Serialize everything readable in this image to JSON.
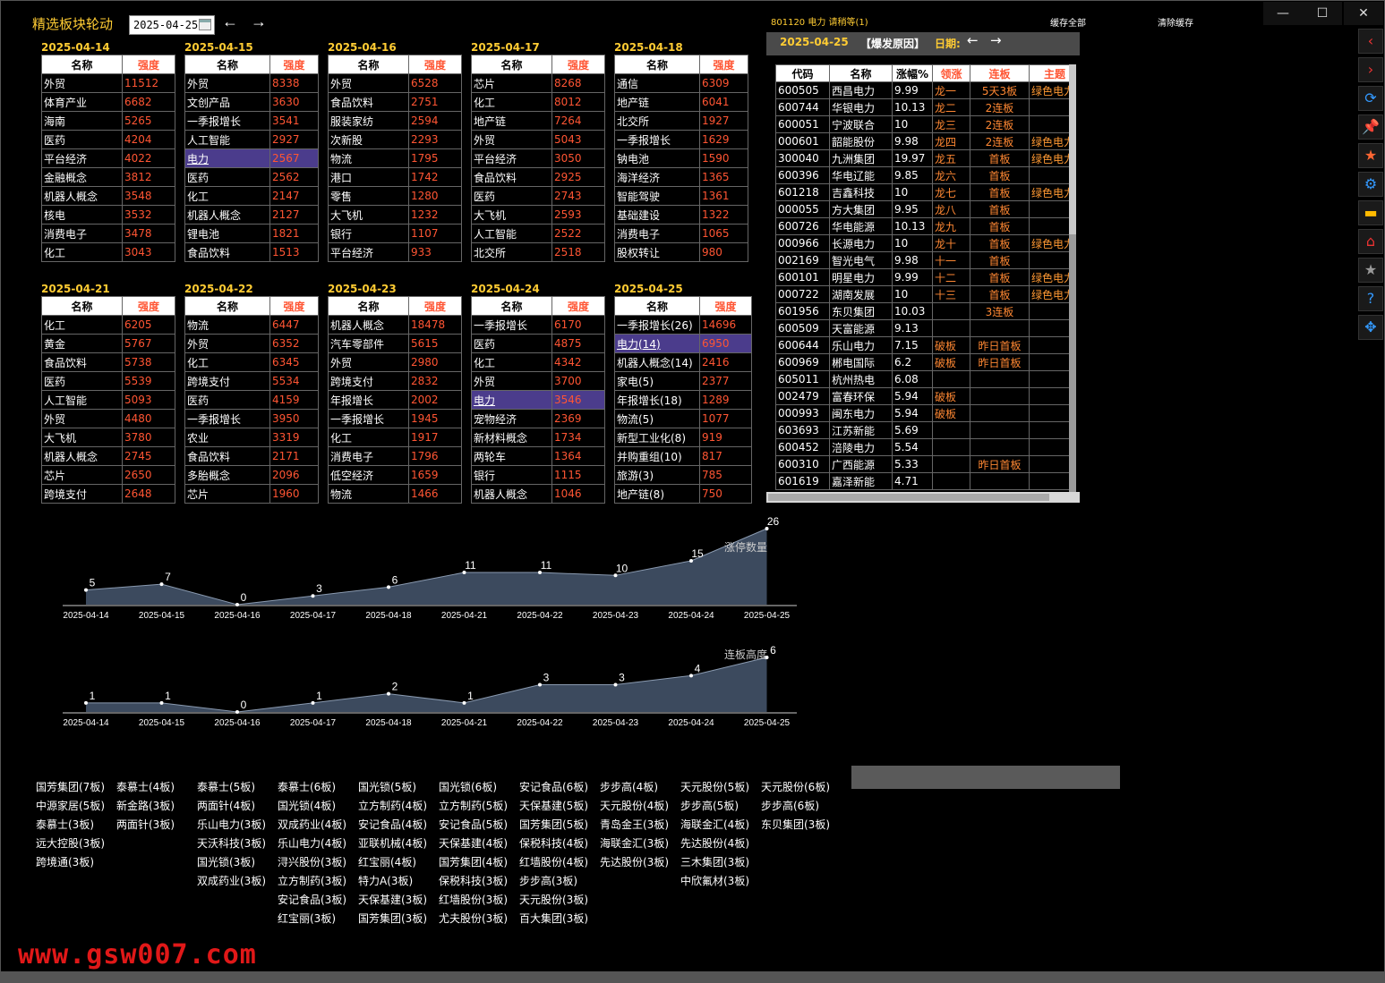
{
  "app_title": "精选板块轮动",
  "date_value": "2025-04-25",
  "nav": {
    "prev": "←",
    "next": "→"
  },
  "top_info": "801120 电力 请稍等(1)",
  "top_links": {
    "cache_all": "缓存全部",
    "clear_cache": "清除缓存"
  },
  "window_controls": {
    "minimize": "—",
    "maximize": "☐",
    "close": "✕"
  },
  "board_headers": {
    "name": "名称",
    "strength": "强度"
  },
  "boards": [
    {
      "date": "2025-04-14",
      "rows": [
        [
          "外贸",
          "11512"
        ],
        [
          "体育产业",
          "6682"
        ],
        [
          "海南",
          "5265"
        ],
        [
          "医药",
          "4204"
        ],
        [
          "平台经济",
          "4022"
        ],
        [
          "金融概念",
          "3812"
        ],
        [
          "机器人概念",
          "3548"
        ],
        [
          "核电",
          "3532"
        ],
        [
          "消费电子",
          "3478"
        ],
        [
          "化工",
          "3043"
        ]
      ],
      "highlight": -1
    },
    {
      "date": "2025-04-15",
      "rows": [
        [
          "外贸",
          "8338"
        ],
        [
          "文创产品",
          "3630"
        ],
        [
          "一季报增长",
          "3541"
        ],
        [
          "人工智能",
          "2927"
        ],
        [
          "电力",
          "2567"
        ],
        [
          "医药",
          "2562"
        ],
        [
          "化工",
          "2147"
        ],
        [
          "机器人概念",
          "2127"
        ],
        [
          "锂电池",
          "1821"
        ],
        [
          "食品饮料",
          "1513"
        ]
      ],
      "highlight": 4
    },
    {
      "date": "2025-04-16",
      "rows": [
        [
          "外贸",
          "6528"
        ],
        [
          "食品饮料",
          "2751"
        ],
        [
          "服装家纺",
          "2594"
        ],
        [
          "次新股",
          "2293"
        ],
        [
          "物流",
          "1795"
        ],
        [
          "港口",
          "1742"
        ],
        [
          "零售",
          "1280"
        ],
        [
          "大飞机",
          "1232"
        ],
        [
          "银行",
          "1107"
        ],
        [
          "平台经济",
          "933"
        ]
      ],
      "highlight": -1
    },
    {
      "date": "2025-04-17",
      "rows": [
        [
          "芯片",
          "8268"
        ],
        [
          "化工",
          "8012"
        ],
        [
          "地产链",
          "7264"
        ],
        [
          "外贸",
          "5043"
        ],
        [
          "平台经济",
          "3050"
        ],
        [
          "食品饮料",
          "2925"
        ],
        [
          "医药",
          "2743"
        ],
        [
          "大飞机",
          "2593"
        ],
        [
          "人工智能",
          "2522"
        ],
        [
          "北交所",
          "2518"
        ]
      ],
      "highlight": -1
    },
    {
      "date": "2025-04-18",
      "rows": [
        [
          "通信",
          "6309"
        ],
        [
          "地产链",
          "6041"
        ],
        [
          "北交所",
          "1927"
        ],
        [
          "一季报增长",
          "1629"
        ],
        [
          "钠电池",
          "1590"
        ],
        [
          "海洋经济",
          "1365"
        ],
        [
          "智能驾驶",
          "1361"
        ],
        [
          "基础建设",
          "1322"
        ],
        [
          "消费电子",
          "1065"
        ],
        [
          "股权转让",
          "980"
        ]
      ],
      "highlight": -1
    },
    {
      "date": "2025-04-21",
      "rows": [
        [
          "化工",
          "6205"
        ],
        [
          "黄金",
          "5767"
        ],
        [
          "食品饮料",
          "5738"
        ],
        [
          "医药",
          "5539"
        ],
        [
          "人工智能",
          "5093"
        ],
        [
          "外贸",
          "4480"
        ],
        [
          "大飞机",
          "3780"
        ],
        [
          "机器人概念",
          "2745"
        ],
        [
          "芯片",
          "2650"
        ],
        [
          "跨境支付",
          "2648"
        ]
      ],
      "highlight": -1
    },
    {
      "date": "2025-04-22",
      "rows": [
        [
          "物流",
          "6447"
        ],
        [
          "外贸",
          "6352"
        ],
        [
          "化工",
          "6345"
        ],
        [
          "跨境支付",
          "5534"
        ],
        [
          "医药",
          "4159"
        ],
        [
          "一季报增长",
          "3950"
        ],
        [
          "农业",
          "3319"
        ],
        [
          "食品饮料",
          "2171"
        ],
        [
          "多胎概念",
          "2096"
        ],
        [
          "芯片",
          "1960"
        ]
      ],
      "highlight": -1
    },
    {
      "date": "2025-04-23",
      "rows": [
        [
          "机器人概念",
          "18478"
        ],
        [
          "汽车零部件",
          "5615"
        ],
        [
          "外贸",
          "2980"
        ],
        [
          "跨境支付",
          "2832"
        ],
        [
          "年报增长",
          "2002"
        ],
        [
          "一季报增长",
          "1945"
        ],
        [
          "化工",
          "1917"
        ],
        [
          "消费电子",
          "1796"
        ],
        [
          "低空经济",
          "1659"
        ],
        [
          "物流",
          "1466"
        ]
      ],
      "highlight": -1
    },
    {
      "date": "2025-04-24",
      "rows": [
        [
          "一季报增长",
          "6170"
        ],
        [
          "医药",
          "4875"
        ],
        [
          "化工",
          "4342"
        ],
        [
          "外贸",
          "3700"
        ],
        [
          "电力",
          "3546"
        ],
        [
          "宠物经济",
          "2369"
        ],
        [
          "新材料概念",
          "1734"
        ],
        [
          "两轮车",
          "1364"
        ],
        [
          "银行",
          "1115"
        ],
        [
          "机器人概念",
          "1046"
        ]
      ],
      "highlight": 4
    },
    {
      "date": "2025-04-25",
      "rows": [
        [
          "一季报增长(26)",
          "14696"
        ],
        [
          "电力(14)",
          "6950"
        ],
        [
          "机器人概念(14)",
          "2416"
        ],
        [
          "家电(5)",
          "2377"
        ],
        [
          "年报增长(18)",
          "1289"
        ],
        [
          "物流(5)",
          "1077"
        ],
        [
          "新型工业化(8)",
          "919"
        ],
        [
          "并购重组(10)",
          "817"
        ],
        [
          "旅游(3)",
          "785"
        ],
        [
          "地产链(8)",
          "750"
        ]
      ],
      "highlight": 1
    }
  ],
  "right_panel": {
    "date": "2025-04-25",
    "reason_label": "【爆发原因】",
    "date_label": "日期:",
    "headers": [
      "代码",
      "名称",
      "涨幅%",
      "领涨",
      "连板",
      "主题"
    ],
    "rows": [
      [
        "600505",
        "西昌电力",
        "9.99",
        "龙一",
        "5天3板",
        "绿色电力"
      ],
      [
        "600744",
        "华银电力",
        "10.13",
        "龙二",
        "2连板",
        ""
      ],
      [
        "600051",
        "宁波联合",
        "10",
        "龙三",
        "2连板",
        ""
      ],
      [
        "000601",
        "韶能股份",
        "9.98",
        "龙四",
        "2连板",
        "绿色电力"
      ],
      [
        "300040",
        "九洲集团",
        "19.97",
        "龙五",
        "首板",
        "绿色电力"
      ],
      [
        "600396",
        "华电辽能",
        "9.85",
        "龙六",
        "首板",
        ""
      ],
      [
        "601218",
        "吉鑫科技",
        "10",
        "龙七",
        "首板",
        "绿色电力"
      ],
      [
        "000055",
        "方大集团",
        "9.95",
        "龙八",
        "首板",
        ""
      ],
      [
        "600726",
        "华电能源",
        "10.13",
        "龙九",
        "首板",
        ""
      ],
      [
        "000966",
        "长源电力",
        "10",
        "龙十",
        "首板",
        "绿色电力"
      ],
      [
        "002169",
        "智光电气",
        "9.98",
        "十一",
        "首板",
        ""
      ],
      [
        "600101",
        "明星电力",
        "9.99",
        "十二",
        "首板",
        "绿色电力"
      ],
      [
        "000722",
        "湖南发展",
        "10",
        "十三",
        "首板",
        "绿色电力"
      ],
      [
        "601956",
        "东贝集团",
        "10.03",
        "",
        "3连板",
        ""
      ],
      [
        "600509",
        "天富能源",
        "9.13",
        "",
        "",
        ""
      ],
      [
        "600644",
        "乐山电力",
        "7.15",
        "破板",
        "昨日首板",
        ""
      ],
      [
        "600969",
        "郴电国际",
        "6.2",
        "破板",
        "昨日首板",
        ""
      ],
      [
        "605011",
        "杭州热电",
        "6.08",
        "",
        "",
        ""
      ],
      [
        "002479",
        "富春环保",
        "5.94",
        "破板",
        "",
        ""
      ],
      [
        "000993",
        "闽东电力",
        "5.94",
        "破板",
        "",
        ""
      ],
      [
        "603693",
        "江苏新能",
        "5.69",
        "",
        "",
        ""
      ],
      [
        "600452",
        "涪陵电力",
        "5.54",
        "",
        "",
        ""
      ],
      [
        "600310",
        "广西能源",
        "5.33",
        "",
        "昨日首板",
        ""
      ],
      [
        "601619",
        "嘉泽新能",
        "4.71",
        "",
        "",
        ""
      ]
    ]
  },
  "side_toolbar": [
    "back-icon",
    "forward-icon",
    "refresh-icon",
    "pin-icon",
    "bookmark-icon",
    "settings-icon",
    "folder-icon",
    "home-icon",
    "star-icon",
    "help-icon",
    "move-icon"
  ],
  "chart_data": [
    {
      "type": "area",
      "title": "涨停数量",
      "x": [
        "2025-04-14",
        "2025-04-15",
        "2025-04-16",
        "2025-04-17",
        "2025-04-18",
        "2025-04-21",
        "2025-04-22",
        "2025-04-23",
        "2025-04-24",
        "2025-04-25"
      ],
      "values": [
        5,
        7,
        0,
        3,
        6,
        11,
        11,
        10,
        15,
        26
      ],
      "ylim": [
        0,
        26
      ],
      "fill": "#3c4a5e"
    },
    {
      "type": "area",
      "title": "连板高度",
      "x": [
        "2025-04-14",
        "2025-04-15",
        "2025-04-16",
        "2025-04-17",
        "2025-04-18",
        "2025-04-21",
        "2025-04-22",
        "2025-04-23",
        "2025-04-24",
        "2025-04-25"
      ],
      "values": [
        1,
        1,
        0,
        1,
        2,
        1,
        3,
        3,
        4,
        6
      ],
      "ylim": [
        0,
        6
      ],
      "fill": "#3c4a5e"
    }
  ],
  "stock_columns": [
    [
      "国芳集团(7板)",
      "中源家居(5板)",
      "泰慕士(3板)",
      "远大控股(3板)",
      "跨境通(3板)"
    ],
    [
      "泰慕士(4板)",
      "新金路(3板)",
      "两面针(3板)"
    ],
    [
      "泰慕士(5板)",
      "两面针(4板)",
      "乐山电力(3板)",
      "天沃科技(3板)",
      "国光锁(3板)",
      "双成药业(3板)"
    ],
    [
      "泰慕士(6板)",
      "国光锁(4板)",
      "双成药业(4板)",
      "乐山电力(4板)",
      "浔兴股份(3板)",
      "立方制药(3板)",
      "安记食品(3板)",
      "红宝丽(3板)"
    ],
    [
      "国光锁(5板)",
      "立方制药(4板)",
      "安记食品(4板)",
      "亚联机械(4板)",
      "红宝丽(4板)",
      "特力A(3板)",
      "天保基建(3板)",
      "国芳集团(3板)"
    ],
    [
      "国光锁(6板)",
      "立方制药(5板)",
      "安记食品(5板)",
      "天保基建(4板)",
      "国芳集团(4板)",
      "保税科技(3板)",
      "红墙股份(3板)",
      "尤夫股份(3板)"
    ],
    [
      "安记食品(6板)",
      "天保基建(5板)",
      "国芳集团(5板)",
      "保税科技(4板)",
      "红墙股份(4板)",
      "步步高(3板)",
      "天元股份(3板)",
      "百大集团(3板)"
    ],
    [
      "步步高(4板)",
      "天元股份(4板)",
      "青岛金王(3板)",
      "海联金汇(3板)",
      "先达股份(3板)"
    ],
    [
      "天元股份(5板)",
      "步步高(5板)",
      "海联金汇(4板)",
      "先达股份(4板)",
      "三木集团(3板)",
      "中欣氟材(3板)"
    ],
    [
      "天元股份(6板)",
      "步步高(6板)",
      "东贝集团(3板)"
    ]
  ],
  "watermark": "www.gsw007.com"
}
